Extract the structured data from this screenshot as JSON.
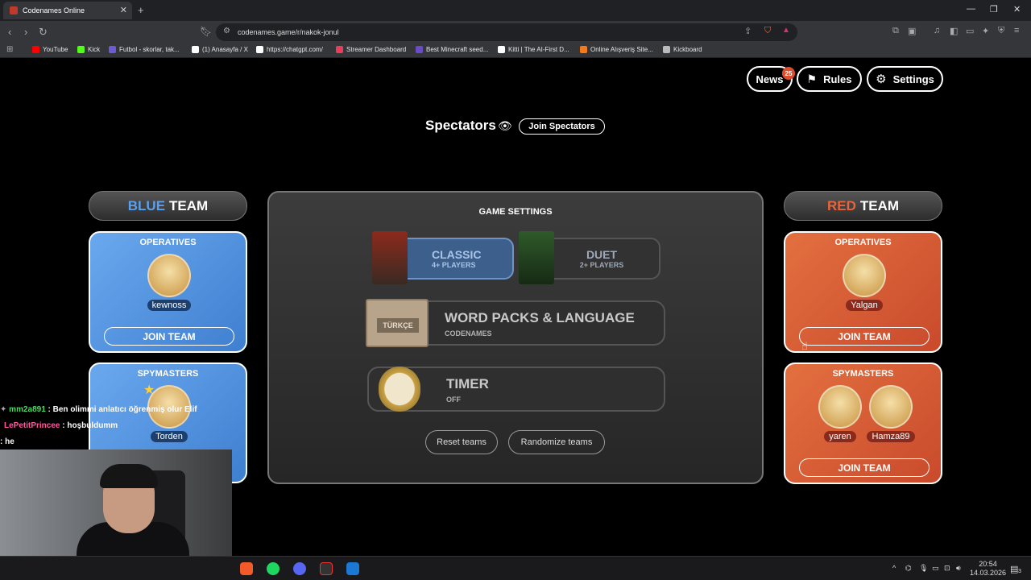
{
  "browser": {
    "tab_title": "Codenames Online",
    "new_tab": "+",
    "url": "codenames.game/r/nakok-jonul",
    "bookmarks": [
      {
        "label": "YouTube",
        "color": "#ff0000"
      },
      {
        "label": "Kick",
        "color": "#53fc18"
      },
      {
        "label": "Futbol - skorlar, tak...",
        "color": "#6b5bd6"
      },
      {
        "label": "(1) Anasayfa / X",
        "color": "#ffffff"
      },
      {
        "label": "https://chatgpt.com/",
        "color": "#ffffff"
      },
      {
        "label": "Streamer Dashboard",
        "color": "#e93d5b"
      },
      {
        "label": "Best Minecraft seed...",
        "color": "#6a4cc4"
      },
      {
        "label": "Kitti | The AI-First D...",
        "color": "#ffffff"
      },
      {
        "label": "Online Alışveriş Site...",
        "color": "#f27a1a"
      },
      {
        "label": "Kickboard",
        "color": "#bbbbbb"
      }
    ]
  },
  "header": {
    "news_label": "News",
    "news_badge": "25",
    "rules_label": "Rules",
    "settings_label": "Settings"
  },
  "spectators": {
    "title": "Spectators",
    "join_label": "Join Spectators"
  },
  "blue_team": {
    "word1": "BLUE",
    "word2": "TEAM",
    "color": "#5aa0ee",
    "operatives_title": "OPERATIVES",
    "operatives": [
      "kewnoss"
    ],
    "join_label": "JOIN TEAM",
    "spymasters_title": "SPYMASTERS",
    "spymasters": [
      "Torden"
    ]
  },
  "red_team": {
    "word1": "RED",
    "word2": "TEAM",
    "color": "#e8643a",
    "operatives_title": "OPERATIVES",
    "operatives": [
      "Yalgan"
    ],
    "join_label": "JOIN TEAM",
    "spymasters_title": "SPYMASTERS",
    "spymasters": [
      "yaren",
      "Hamza89"
    ],
    "spy_join_label": "JOIN TEAM"
  },
  "game_settings": {
    "title": "GAME SETTINGS",
    "classic": {
      "title": "CLASSIC",
      "sub": "4+ PLAYERS",
      "selected": true
    },
    "duet": {
      "title": "DUET",
      "sub": "2+ PLAYERS"
    },
    "word_packs": {
      "title": "WORD PACKS & LANGUAGE",
      "sub": "CODENAMES",
      "box_label": "TÜRKÇE"
    },
    "timer": {
      "title": "TIMER",
      "sub": "OFF"
    },
    "reset_label": "Reset teams",
    "randomize_label": "Randomize teams"
  },
  "chat": [
    {
      "user": "mm2a891",
      "user_color": "#4cd964",
      "text": " : Ben olimmi anlatıcı öğrenmiş olur Elif"
    },
    {
      "user": "LePetitPrincee",
      "user_color": "#ff5aa0",
      "text": " : hoşbuldumm"
    },
    {
      "user": "",
      "user_color": "#ffffff",
      "text": ": he"
    }
  ],
  "taskbar": {
    "time": "20:54",
    "date": "14.03.2026",
    "notif_count": "3"
  }
}
